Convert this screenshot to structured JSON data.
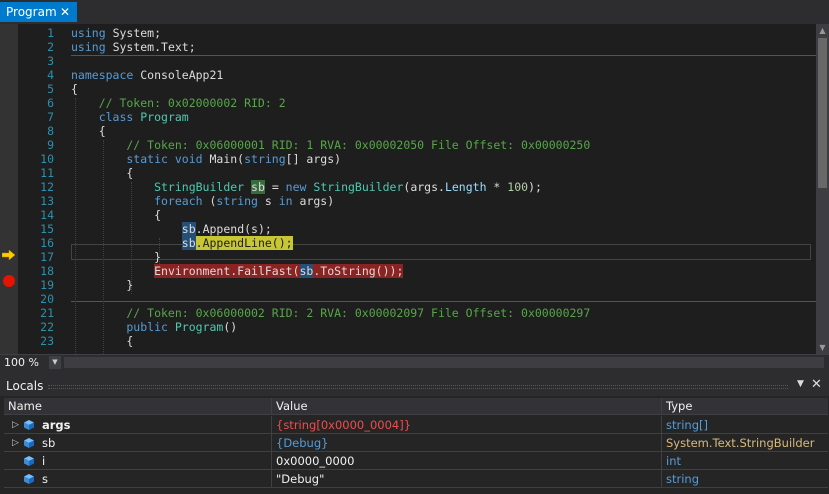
{
  "tab": {
    "label": "Program",
    "close": "✕"
  },
  "editor": {
    "lines": [
      {
        "n": "1",
        "segments": [
          [
            "kw",
            "using"
          ],
          [
            "plain",
            " "
          ],
          [
            "plain",
            "System;"
          ]
        ]
      },
      {
        "n": "2",
        "segments": [
          [
            "kw",
            "using"
          ],
          [
            "plain",
            " "
          ],
          [
            "plain",
            "System.Text;"
          ]
        ]
      },
      {
        "n": "3",
        "segments": []
      },
      {
        "n": "4",
        "segments": [
          [
            "kw",
            "namespace"
          ],
          [
            "plain",
            " ConsoleApp21"
          ]
        ]
      },
      {
        "n": "5",
        "segments": [
          [
            "plain",
            "{"
          ]
        ]
      },
      {
        "n": "6",
        "segments": [
          [
            "cm",
            "    // Token: 0x02000002 RID: 2"
          ]
        ]
      },
      {
        "n": "7",
        "segments": [
          [
            "kw",
            "    class"
          ],
          [
            "plain",
            " "
          ],
          [
            "cls",
            "Program"
          ]
        ]
      },
      {
        "n": "8",
        "segments": [
          [
            "plain",
            "    {"
          ]
        ]
      },
      {
        "n": "9",
        "segments": [
          [
            "cm",
            "        // Token: 0x06000001 RID: 1 RVA: 0x00002050 File Offset: 0x00000250"
          ]
        ]
      },
      {
        "n": "10",
        "segments": [
          [
            "kw",
            "        static void"
          ],
          [
            "plain",
            " Main("
          ],
          [
            "kw",
            "string"
          ],
          [
            "plain",
            "[] args)"
          ]
        ]
      },
      {
        "n": "11",
        "segments": [
          [
            "plain",
            "        {"
          ]
        ]
      },
      {
        "n": "12",
        "segments": [
          [
            "cls",
            "            StringBuilder"
          ],
          [
            "plain",
            " "
          ],
          [
            "hlg",
            "sb"
          ],
          [
            "plain",
            " = "
          ],
          [
            "kw",
            "new"
          ],
          [
            "plain",
            " "
          ],
          [
            "cls",
            "StringBuilder"
          ],
          [
            "plain",
            "(args."
          ],
          [
            "prop",
            "Length"
          ],
          [
            "plain",
            " * "
          ],
          [
            "num",
            "100"
          ],
          [
            "plain",
            ");"
          ]
        ]
      },
      {
        "n": "13",
        "segments": [
          [
            "kw",
            "            foreach"
          ],
          [
            "plain",
            " ("
          ],
          [
            "kw",
            "string"
          ],
          [
            "plain",
            " s "
          ],
          [
            "kw",
            "in"
          ],
          [
            "plain",
            " args)"
          ]
        ]
      },
      {
        "n": "14",
        "segments": [
          [
            "plain",
            "            {"
          ]
        ]
      },
      {
        "n": "15",
        "segments": [
          [
            "plain",
            "                "
          ],
          [
            "hlb",
            "sb"
          ],
          [
            "plain",
            "."
          ],
          [
            "plain",
            "Append(s);"
          ]
        ]
      },
      {
        "n": "16",
        "segments": [
          [
            "plain",
            "                "
          ],
          [
            "hlb",
            "sb"
          ],
          [
            "hly",
            ".AppendLine();"
          ]
        ]
      },
      {
        "n": "17",
        "segments": [
          [
            "plain",
            "            }"
          ]
        ]
      },
      {
        "n": "18",
        "segments": [
          [
            "plain",
            "            "
          ],
          [
            "hlr",
            "Environment.FailFast("
          ],
          [
            "hlrb",
            "sb"
          ],
          [
            "hlr",
            ".ToString());"
          ]
        ]
      },
      {
        "n": "19",
        "segments": [
          [
            "plain",
            "        }"
          ]
        ]
      },
      {
        "n": "20",
        "segments": []
      },
      {
        "n": "21",
        "segments": [
          [
            "cm",
            "        // Token: 0x06000002 RID: 2 RVA: 0x00002097 File Offset: 0x00000297"
          ]
        ]
      },
      {
        "n": "22",
        "segments": [
          [
            "kw",
            "        public"
          ],
          [
            "plain",
            " "
          ],
          [
            "cls",
            "Program"
          ],
          [
            "plain",
            "()"
          ]
        ]
      },
      {
        "n": "23",
        "segments": [
          [
            "plain",
            "        {"
          ]
        ]
      }
    ]
  },
  "zoom": {
    "level": "100 %",
    "dropdown": "▼"
  },
  "locals": {
    "title": "Locals",
    "menu": "▼",
    "close": "✕",
    "columns": {
      "name": "Name",
      "value": "Value",
      "type": "Type"
    },
    "rows": [
      {
        "expand": "▷",
        "name": "args",
        "value": "{string[0x0000_0004]}",
        "type": "string[]",
        "value_style": "red",
        "type_style": "blue",
        "bold": true
      },
      {
        "expand": "▷",
        "name": "sb",
        "value": "{Debug}",
        "type": "System.Text.StringBuilder",
        "value_style": "blue",
        "type_style": "yellow",
        "bold": false
      },
      {
        "expand": "",
        "name": "i",
        "value": "0x0000_0000",
        "type": "int",
        "value_style": "plain",
        "type_style": "blue",
        "bold": false
      },
      {
        "expand": "",
        "name": "s",
        "value": "\"Debug\"",
        "type": "string",
        "value_style": "plain",
        "type_style": "blue",
        "bold": false
      }
    ]
  },
  "colors": {
    "accent": "#007acc",
    "breakpoint": "#e51400",
    "instruction_pointer": "#ffcc00"
  }
}
